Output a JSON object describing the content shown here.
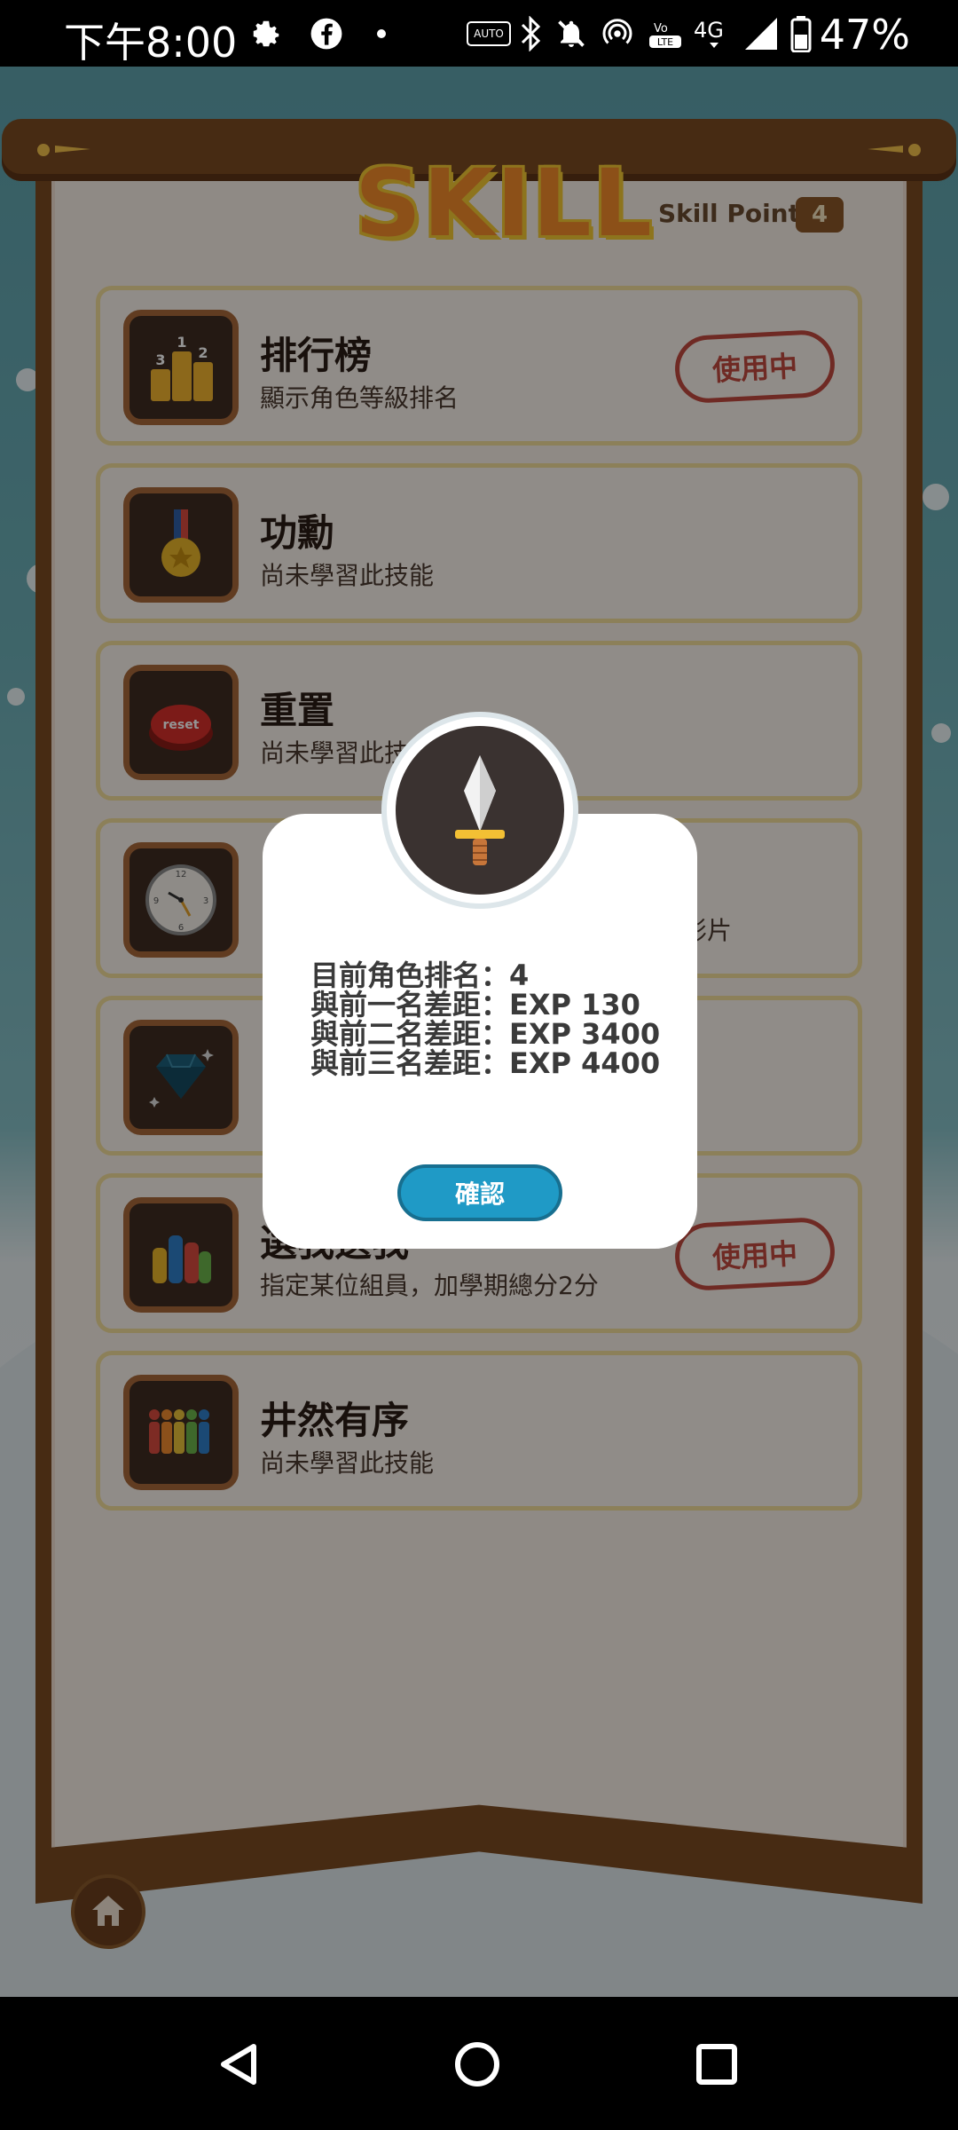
{
  "status_bar": {
    "time": "下午8:00",
    "battery_percent": "47%",
    "icons": [
      "gear-icon",
      "facebook-icon",
      "dot-icon",
      "auto-hz-icon",
      "bluetooth-icon",
      "mute-icon",
      "hotspot-icon",
      "volte-icon",
      "4g-icon",
      "signal-icon",
      "battery-icon"
    ]
  },
  "header": {
    "title": "SKILL",
    "skill_point_label": "Skill Point",
    "skill_point_value": "4"
  },
  "skills": [
    {
      "name": "排行榜",
      "desc": "顯示角色等級排名",
      "badge": "使用中",
      "icon": "podium-icon"
    },
    {
      "name": "功勳",
      "desc": "尚未學習此技能",
      "icon": "medal-icon"
    },
    {
      "name": "重置",
      "desc": "尚未學習此技",
      "icon": "reset-button-icon"
    },
    {
      "name": "",
      "desc": "段影片",
      "icon": "clock-icon"
    },
    {
      "name": "",
      "desc": "",
      "icon": "diamond-icon"
    },
    {
      "name": "選我選我",
      "desc": "指定某位組員，加學期總分2分",
      "badge": "使用中",
      "icon": "raised-hands-icon"
    },
    {
      "name": "井然有序",
      "desc": "尚未學習此技能",
      "icon": "queue-people-icon"
    }
  ],
  "dialog": {
    "icon": "sword-icon",
    "lines": [
      "目前角色排名：4",
      "與前一名差距：EXP 130",
      "與前二名差距：EXP 3400",
      "與前三名差距：EXP 4400"
    ],
    "confirm_label": "確認"
  },
  "nav": {
    "home_icon": "home-icon",
    "buttons": [
      "back-icon",
      "home-circle-icon",
      "recents-icon"
    ]
  }
}
